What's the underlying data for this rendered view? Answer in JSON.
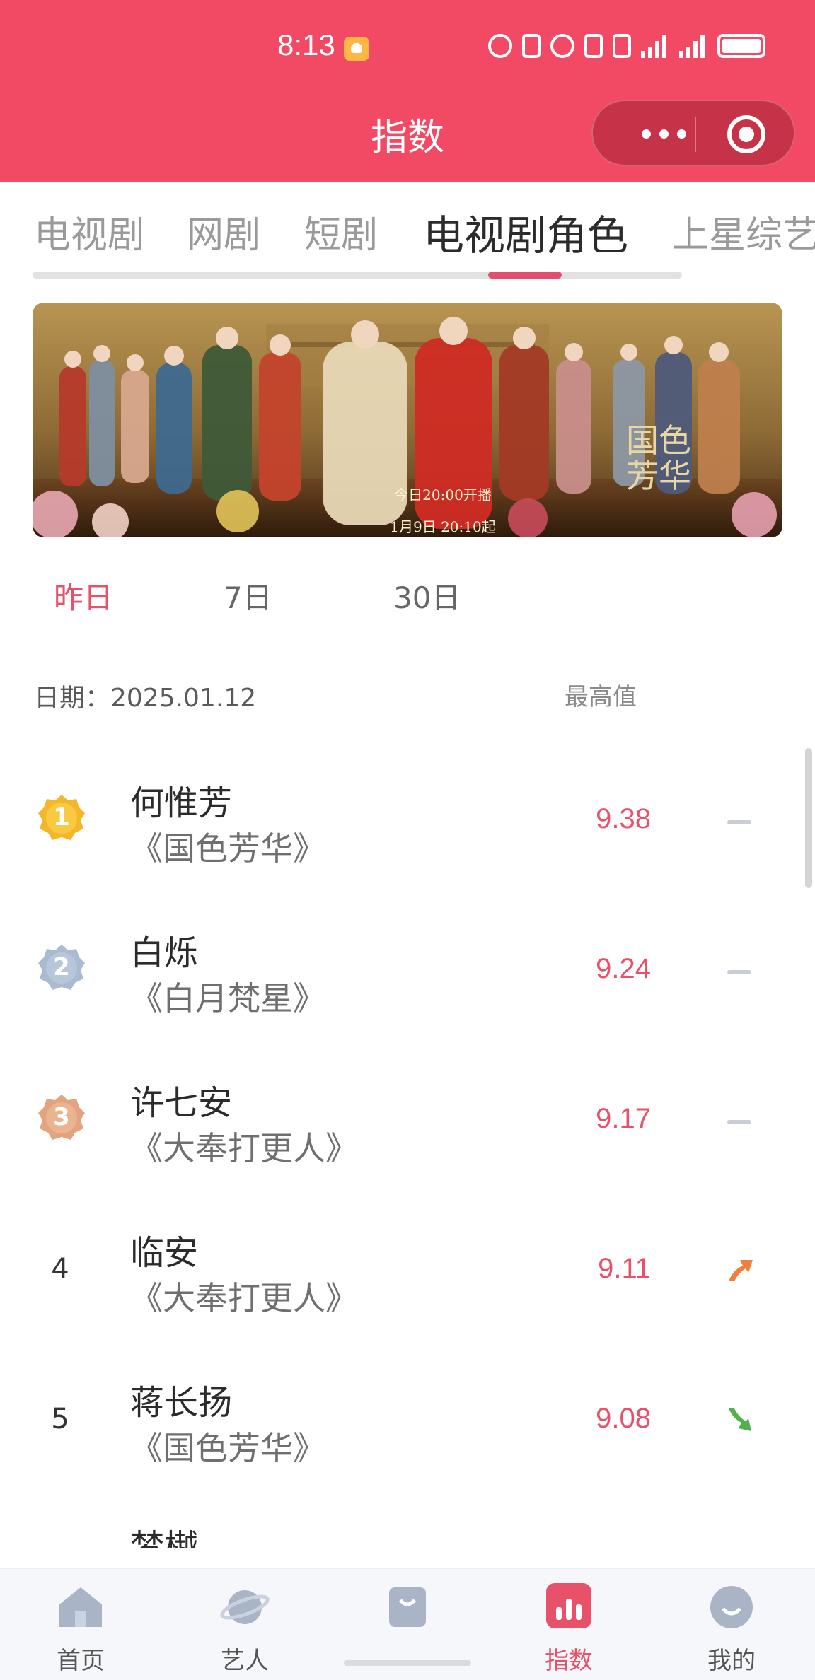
{
  "status_bar": {
    "time": "8:13"
  },
  "nav": {
    "title": "指数"
  },
  "category_tabs": [
    {
      "label": "电视剧",
      "active": false
    },
    {
      "label": "网剧",
      "active": false
    },
    {
      "label": "短剧",
      "active": false
    },
    {
      "label": "电视剧角色",
      "active": true
    },
    {
      "label": "上星综艺",
      "active": false
    }
  ],
  "banner": {
    "line1": "今日20:00开播",
    "line2": "1月9日 20:10起",
    "logo": "国色芳华"
  },
  "period_tabs": [
    {
      "label": "昨日",
      "active": true
    },
    {
      "label": "7日",
      "active": false
    },
    {
      "label": "30日",
      "active": false
    }
  ],
  "date_label": "日期：2025.01.12",
  "max_label": "最高值",
  "rankings": [
    {
      "rank": "1",
      "name": "何惟芳",
      "drama": "《国色芳华》",
      "score": "9.38",
      "trend": "flat"
    },
    {
      "rank": "2",
      "name": "白烁",
      "drama": "《白月梵星》",
      "score": "9.24",
      "trend": "flat"
    },
    {
      "rank": "3",
      "name": "许七安",
      "drama": "《大奉打更人》",
      "score": "9.17",
      "trend": "flat"
    },
    {
      "rank": "4",
      "name": "临安",
      "drama": "《大奉打更人》",
      "score": "9.11",
      "trend": "up"
    },
    {
      "rank": "5",
      "name": "蒋长扬",
      "drama": "《国色芳华》",
      "score": "9.08",
      "trend": "down"
    }
  ],
  "partial_next": "梦樾",
  "bottom_tabs": [
    {
      "label": "首页",
      "icon": "home-icon",
      "active": false
    },
    {
      "label": "艺人",
      "icon": "planet-icon",
      "active": false
    },
    {
      "label": "",
      "icon": "bag-icon",
      "active": false
    },
    {
      "label": "指数",
      "icon": "chart-icon",
      "active": true
    },
    {
      "label": "我的",
      "icon": "profile-icon",
      "active": false
    }
  ],
  "colors": {
    "header": "#f24a64",
    "accent": "#e7526a",
    "gold": "#f5b72a",
    "silver": "#9fb2c8",
    "bronze": "#dfa07c",
    "trend_up": "#f0813d",
    "trend_down": "#55b14f"
  }
}
